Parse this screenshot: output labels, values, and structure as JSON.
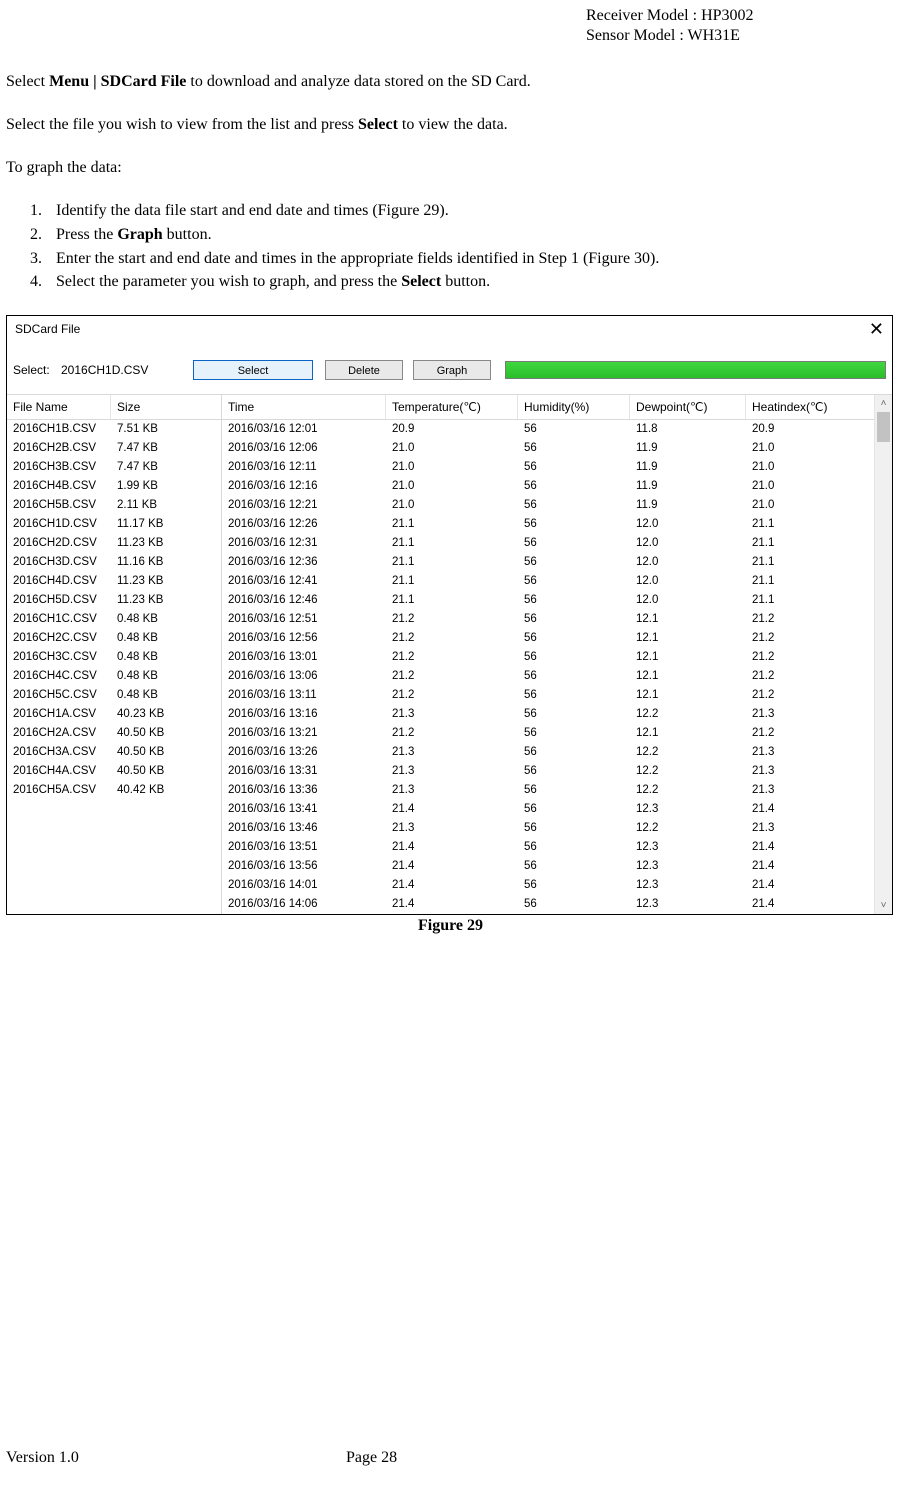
{
  "header": {
    "receiver_label": "Receiver Model : HP3002",
    "sensor_label": "Sensor Model : WH31E"
  },
  "intro": {
    "p1_a": "Select ",
    "p1_b": "Menu | SDCard File",
    "p1_c": " to download and analyze data stored on the SD Card.",
    "p2_a": "Select the file you wish to view from the list and press ",
    "p2_b": "Select",
    "p2_c": " to view the data.",
    "p3": "To graph the data:"
  },
  "list": {
    "i1": "Identify the data file start and end date and times (Figure 29).",
    "i2_a": "Press the ",
    "i2_b": "Graph",
    "i2_c": " button.",
    "i3": "Enter the start and end date and times in the appropriate fields identified in Step 1 (Figure 30).",
    "i4_a": "Select the parameter you wish to graph, and press the ",
    "i4_b": "Select",
    "i4_c": " button."
  },
  "window": {
    "title": "SDCard File",
    "close": "✕",
    "select_label": "Select:",
    "select_value": "2016CH1D.CSV",
    "btn_select": "Select",
    "btn_delete": "Delete",
    "btn_graph": "Graph"
  },
  "file_headers": {
    "c1": "File Name",
    "c2": "Size"
  },
  "data_headers": {
    "c1": "Time",
    "c2": "Temperature(℃)",
    "c3": "Humidity(%)",
    "c4": "Dewpoint(℃)",
    "c5": "Heatindex(℃)"
  },
  "files": [
    {
      "name": "2016CH1B.CSV",
      "size": "7.51 KB"
    },
    {
      "name": "2016CH2B.CSV",
      "size": "7.47 KB"
    },
    {
      "name": "2016CH3B.CSV",
      "size": "7.47 KB"
    },
    {
      "name": "2016CH4B.CSV",
      "size": "1.99 KB"
    },
    {
      "name": "2016CH5B.CSV",
      "size": "2.11 KB"
    },
    {
      "name": "2016CH1D.CSV",
      "size": "11.17 KB"
    },
    {
      "name": "2016CH2D.CSV",
      "size": "11.23 KB"
    },
    {
      "name": "2016CH3D.CSV",
      "size": "11.16 KB"
    },
    {
      "name": "2016CH4D.CSV",
      "size": "11.23 KB"
    },
    {
      "name": "2016CH5D.CSV",
      "size": "11.23 KB"
    },
    {
      "name": "2016CH1C.CSV",
      "size": "0.48 KB"
    },
    {
      "name": "2016CH2C.CSV",
      "size": "0.48 KB"
    },
    {
      "name": "2016CH3C.CSV",
      "size": "0.48 KB"
    },
    {
      "name": "2016CH4C.CSV",
      "size": "0.48 KB"
    },
    {
      "name": "2016CH5C.CSV",
      "size": "0.48 KB"
    },
    {
      "name": "2016CH1A.CSV",
      "size": "40.23 KB"
    },
    {
      "name": "2016CH2A.CSV",
      "size": "40.50 KB"
    },
    {
      "name": "2016CH3A.CSV",
      "size": "40.50 KB"
    },
    {
      "name": "2016CH4A.CSV",
      "size": "40.50 KB"
    },
    {
      "name": "2016CH5A.CSV",
      "size": "40.42 KB"
    }
  ],
  "data_rows": [
    {
      "t": "2016/03/16 12:01",
      "a": "20.9",
      "b": "56",
      "c": "11.8",
      "d": "20.9"
    },
    {
      "t": "2016/03/16 12:06",
      "a": "21.0",
      "b": "56",
      "c": "11.9",
      "d": "21.0"
    },
    {
      "t": "2016/03/16 12:11",
      "a": "21.0",
      "b": "56",
      "c": "11.9",
      "d": "21.0"
    },
    {
      "t": "2016/03/16 12:16",
      "a": "21.0",
      "b": "56",
      "c": "11.9",
      "d": "21.0"
    },
    {
      "t": "2016/03/16 12:21",
      "a": "21.0",
      "b": "56",
      "c": "11.9",
      "d": "21.0"
    },
    {
      "t": "2016/03/16 12:26",
      "a": "21.1",
      "b": "56",
      "c": "12.0",
      "d": "21.1"
    },
    {
      "t": "2016/03/16 12:31",
      "a": "21.1",
      "b": "56",
      "c": "12.0",
      "d": "21.1"
    },
    {
      "t": "2016/03/16 12:36",
      "a": "21.1",
      "b": "56",
      "c": "12.0",
      "d": "21.1"
    },
    {
      "t": "2016/03/16 12:41",
      "a": "21.1",
      "b": "56",
      "c": "12.0",
      "d": "21.1"
    },
    {
      "t": "2016/03/16 12:46",
      "a": "21.1",
      "b": "56",
      "c": "12.0",
      "d": "21.1"
    },
    {
      "t": "2016/03/16 12:51",
      "a": "21.2",
      "b": "56",
      "c": "12.1",
      "d": "21.2"
    },
    {
      "t": "2016/03/16 12:56",
      "a": "21.2",
      "b": "56",
      "c": "12.1",
      "d": "21.2"
    },
    {
      "t": "2016/03/16 13:01",
      "a": "21.2",
      "b": "56",
      "c": "12.1",
      "d": "21.2"
    },
    {
      "t": "2016/03/16 13:06",
      "a": "21.2",
      "b": "56",
      "c": "12.1",
      "d": "21.2"
    },
    {
      "t": "2016/03/16 13:11",
      "a": "21.2",
      "b": "56",
      "c": "12.1",
      "d": "21.2"
    },
    {
      "t": "2016/03/16 13:16",
      "a": "21.3",
      "b": "56",
      "c": "12.2",
      "d": "21.3"
    },
    {
      "t": "2016/03/16 13:21",
      "a": "21.2",
      "b": "56",
      "c": "12.1",
      "d": "21.2"
    },
    {
      "t": "2016/03/16 13:26",
      "a": "21.3",
      "b": "56",
      "c": "12.2",
      "d": "21.3"
    },
    {
      "t": "2016/03/16 13:31",
      "a": "21.3",
      "b": "56",
      "c": "12.2",
      "d": "21.3"
    },
    {
      "t": "2016/03/16 13:36",
      "a": "21.3",
      "b": "56",
      "c": "12.2",
      "d": "21.3"
    },
    {
      "t": "2016/03/16 13:41",
      "a": "21.4",
      "b": "56",
      "c": "12.3",
      "d": "21.4"
    },
    {
      "t": "2016/03/16 13:46",
      "a": "21.3",
      "b": "56",
      "c": "12.2",
      "d": "21.3"
    },
    {
      "t": "2016/03/16 13:51",
      "a": "21.4",
      "b": "56",
      "c": "12.3",
      "d": "21.4"
    },
    {
      "t": "2016/03/16 13:56",
      "a": "21.4",
      "b": "56",
      "c": "12.3",
      "d": "21.4"
    },
    {
      "t": "2016/03/16 14:01",
      "a": "21.4",
      "b": "56",
      "c": "12.3",
      "d": "21.4"
    },
    {
      "t": "2016/03/16 14:06",
      "a": "21.4",
      "b": "56",
      "c": "12.3",
      "d": "21.4"
    }
  ],
  "figure_caption": "Figure 29",
  "footer": {
    "version": "Version 1.0",
    "page": "Page 28"
  }
}
